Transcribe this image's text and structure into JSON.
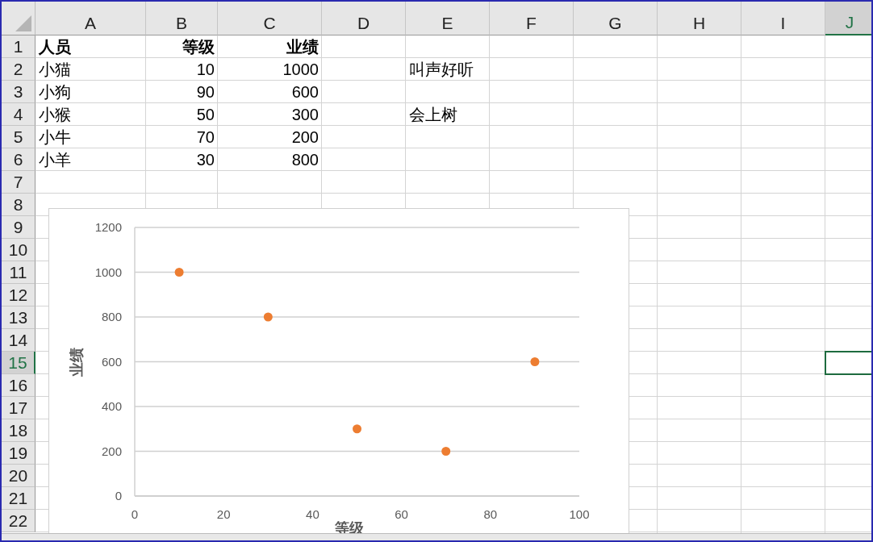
{
  "sheet": {
    "columns": [
      {
        "label": "A",
        "selected": false
      },
      {
        "label": "B",
        "selected": false
      },
      {
        "label": "C",
        "selected": false
      },
      {
        "label": "D",
        "selected": false
      },
      {
        "label": "E",
        "selected": false
      },
      {
        "label": "F",
        "selected": false
      },
      {
        "label": "G",
        "selected": false
      },
      {
        "label": "H",
        "selected": false
      },
      {
        "label": "I",
        "selected": false
      },
      {
        "label": "J",
        "selected": true
      }
    ],
    "rows": [
      {
        "label": "1",
        "selected": false,
        "bold": true,
        "cells": {
          "a": "人员",
          "b": "等级",
          "c": "业绩"
        }
      },
      {
        "label": "2",
        "selected": false,
        "cells": {
          "a": "小猫",
          "b": "10",
          "c": "1000",
          "e": "叫声好听"
        }
      },
      {
        "label": "3",
        "selected": false,
        "cells": {
          "a": "小狗",
          "b": "90",
          "c": "600"
        }
      },
      {
        "label": "4",
        "selected": false,
        "cells": {
          "a": "小猴",
          "b": "50",
          "c": "300",
          "e": "会上树"
        }
      },
      {
        "label": "5",
        "selected": false,
        "cells": {
          "a": "小牛",
          "b": "70",
          "c": "200"
        }
      },
      {
        "label": "6",
        "selected": false,
        "cells": {
          "a": "小羊",
          "b": "30",
          "c": "800"
        }
      },
      {
        "label": "7",
        "selected": false
      },
      {
        "label": "8",
        "selected": false
      },
      {
        "label": "9",
        "selected": false
      },
      {
        "label": "10",
        "selected": false
      },
      {
        "label": "11",
        "selected": false
      },
      {
        "label": "12",
        "selected": false
      },
      {
        "label": "13",
        "selected": false
      },
      {
        "label": "14",
        "selected": false
      },
      {
        "label": "15",
        "selected": true
      },
      {
        "label": "16",
        "selected": false
      },
      {
        "label": "17",
        "selected": false
      },
      {
        "label": "18",
        "selected": false
      },
      {
        "label": "19",
        "selected": false
      },
      {
        "label": "20",
        "selected": false
      },
      {
        "label": "21",
        "selected": false
      },
      {
        "label": "22",
        "selected": false
      }
    ]
  },
  "chart": {
    "chart_data": {
      "type": "scatter",
      "grid": true,
      "xlabel": "等级",
      "ylabel": "业绩",
      "x": [
        10,
        90,
        50,
        70,
        30
      ],
      "series": [
        {
          "color": "#ed7d31",
          "values": [
            1000,
            600,
            300,
            200,
            800
          ]
        }
      ],
      "xlim": [
        0,
        100
      ],
      "ylim": [
        0,
        1200
      ],
      "xticks": [
        0,
        20,
        40,
        60,
        80,
        100
      ],
      "yticks": [
        0,
        200,
        400,
        600,
        800,
        1000,
        1200
      ]
    }
  }
}
